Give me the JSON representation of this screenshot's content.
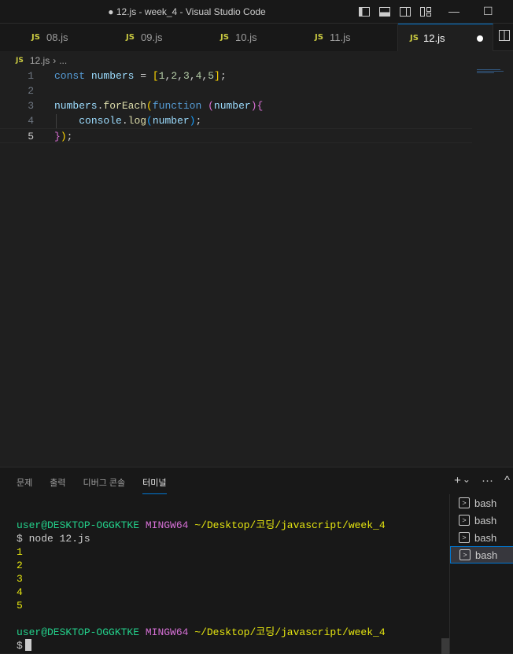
{
  "window": {
    "title": "● 12.js - week_4 - Visual Studio Code",
    "minimize": "—",
    "maximize": "☐"
  },
  "tabs": [
    {
      "lang": "JS",
      "label": "08.js"
    },
    {
      "lang": "JS",
      "label": "09.js"
    },
    {
      "lang": "JS",
      "label": "10.js"
    },
    {
      "lang": "JS",
      "label": "11.js"
    },
    {
      "lang": "JS",
      "label": "12.js"
    }
  ],
  "breadcrumb": {
    "lang": "JS",
    "file": "12.js",
    "sep": "›",
    "more": "..."
  },
  "editor": {
    "line_numbers": [
      "1",
      "2",
      "3",
      "4",
      "5"
    ],
    "lines": [
      "const numbers = [1,2,3,4,5];",
      "",
      "numbers.forEach(function (number){",
      "    console.log(number);",
      "});"
    ],
    "current_line": 5
  },
  "panel": {
    "tabs": [
      "문제",
      "출력",
      "디버그 콘솔",
      "터미널"
    ],
    "active_tab": "터미널",
    "actions": {
      "add": "+",
      "dropdown": "⌄",
      "more": "···",
      "collapse": "^"
    }
  },
  "terminal": {
    "user": "user@DESKTOP-OGGKTKE",
    "system": "MINGW64",
    "path": "~/Desktop/코딩/javascript/week_4",
    "prompt": "$",
    "command": "node 12.js",
    "output": [
      "1",
      "2",
      "3",
      "4",
      "5"
    ]
  },
  "terminal_list": [
    "bash",
    "bash",
    "bash",
    "bash"
  ],
  "colors": {
    "accent": "#0078d4",
    "js_badge": "#cbcb41",
    "terminal_green": "#23d18b",
    "terminal_magenta": "#d670d6",
    "terminal_yellow": "#e5e510"
  }
}
